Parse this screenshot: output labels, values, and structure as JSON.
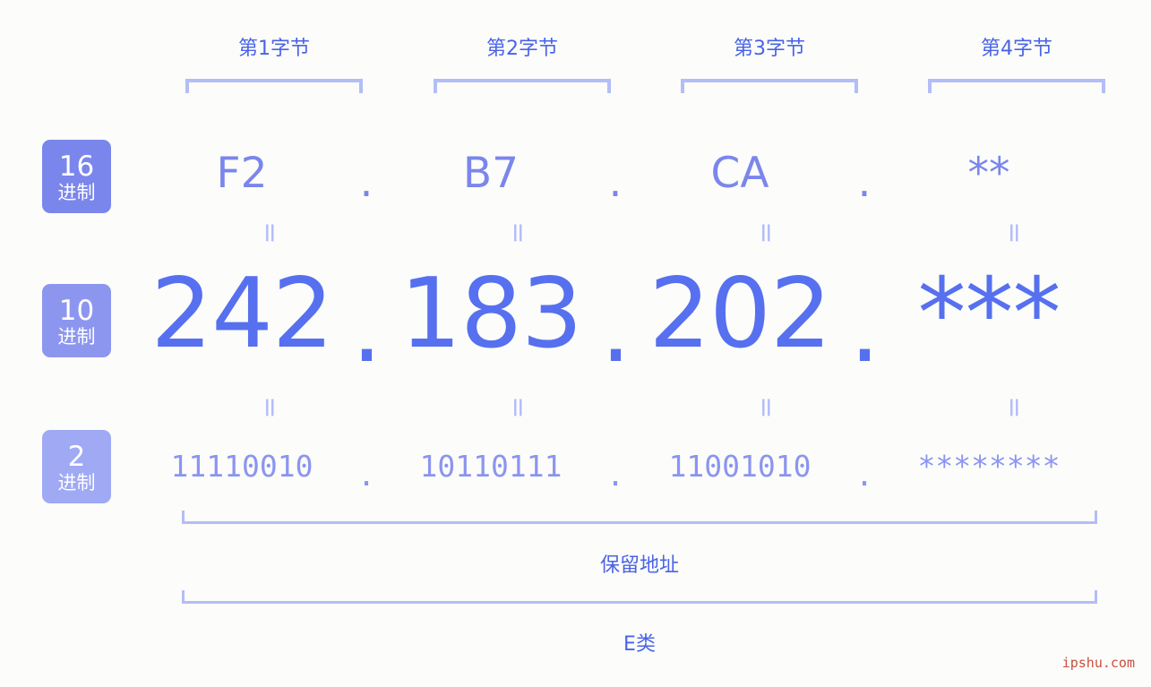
{
  "background_color": "#fcfdfa",
  "accent_color": "#5670ef",
  "byte_headers": [
    {
      "label": "第1字节"
    },
    {
      "label": "第2字节"
    },
    {
      "label": "第3字节"
    },
    {
      "label": "第4字节"
    }
  ],
  "badges": [
    {
      "num": "16",
      "sub": "进制",
      "color": "#7b86ec"
    },
    {
      "num": "10",
      "sub": "进制",
      "color": "#8d96ef"
    },
    {
      "num": "2",
      "sub": "进制",
      "color": "#9fa9f4"
    }
  ],
  "rows": {
    "hex": {
      "base": "16",
      "values": [
        "F2",
        "B7",
        "CA",
        "**"
      ],
      "separator": "."
    },
    "decimal": {
      "base": "10",
      "values": [
        "242",
        "183",
        "202",
        "***"
      ],
      "separator": "."
    },
    "binary": {
      "base": "2",
      "values": [
        "11110010",
        "10110111",
        "11001010",
        "********"
      ],
      "separator": "."
    }
  },
  "equals_symbol": "=",
  "summary": {
    "reserved_label": "保留地址",
    "class_label": "E类"
  },
  "watermark": "ipshu.com"
}
